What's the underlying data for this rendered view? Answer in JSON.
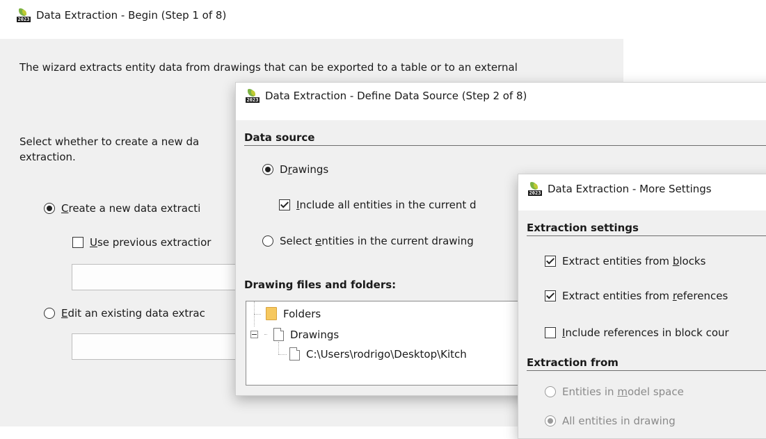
{
  "colors": {
    "background": "#ffffff",
    "window_bg": "#f0f0f0",
    "text": "#1a1a1a",
    "disabled_text": "#8a8a8a"
  },
  "app_icon": {
    "label": "2023"
  },
  "begin": {
    "title": "Data Extraction - Begin (Step 1 of 8)",
    "intro": "The wizard extracts entity data from drawings that can be exported to a table or to an external",
    "select_text_line1": "Select whether to create a new da",
    "select_text_line2": "extraction.",
    "option_create": {
      "accel": "C",
      "rest": "reate a new data extracti",
      "selected": true
    },
    "option_use_previous": {
      "accel": "U",
      "rest": "se previous extractior",
      "checked": false
    },
    "option_edit": {
      "accel": "E",
      "rest": "dit an existing data extrac",
      "selected": false
    }
  },
  "define": {
    "title": "Data Extraction - Define Data Source (Step 2 of 8)",
    "section_data_source": "Data source",
    "option_drawings": {
      "pre": "D",
      "accel": "r",
      "rest": "awings",
      "selected": true
    },
    "include_all": {
      "accel": "I",
      "rest": "nclude all entities in the current d",
      "checked": true
    },
    "option_select": {
      "pre": "Select ",
      "accel": "e",
      "rest": "ntities in the current drawing",
      "selected": false
    },
    "section_files": "Drawing files and folders:",
    "tree": {
      "folders": "Folders",
      "drawings": "Drawings",
      "path": "C:\\Users\\rodrigo\\Desktop\\Kitch"
    }
  },
  "more": {
    "title": "Data Extraction - More Settings",
    "section_settings": "Extraction settings",
    "from_blocks": {
      "pre": "Extract entities from ",
      "accel": "b",
      "rest": "locks",
      "checked": true
    },
    "from_refs": {
      "pre": "Extract entities from ",
      "accel": "r",
      "rest": "eferences",
      "checked": true
    },
    "include_refs": {
      "accel": "I",
      "rest": "nclude references in block cour",
      "checked": false
    },
    "section_from": "Extraction from",
    "model_space": {
      "pre": "Entities in ",
      "accel": "m",
      "rest": "odel space",
      "selected": false
    },
    "all_entities": {
      "text": "All entities in drawing",
      "selected": true
    }
  }
}
